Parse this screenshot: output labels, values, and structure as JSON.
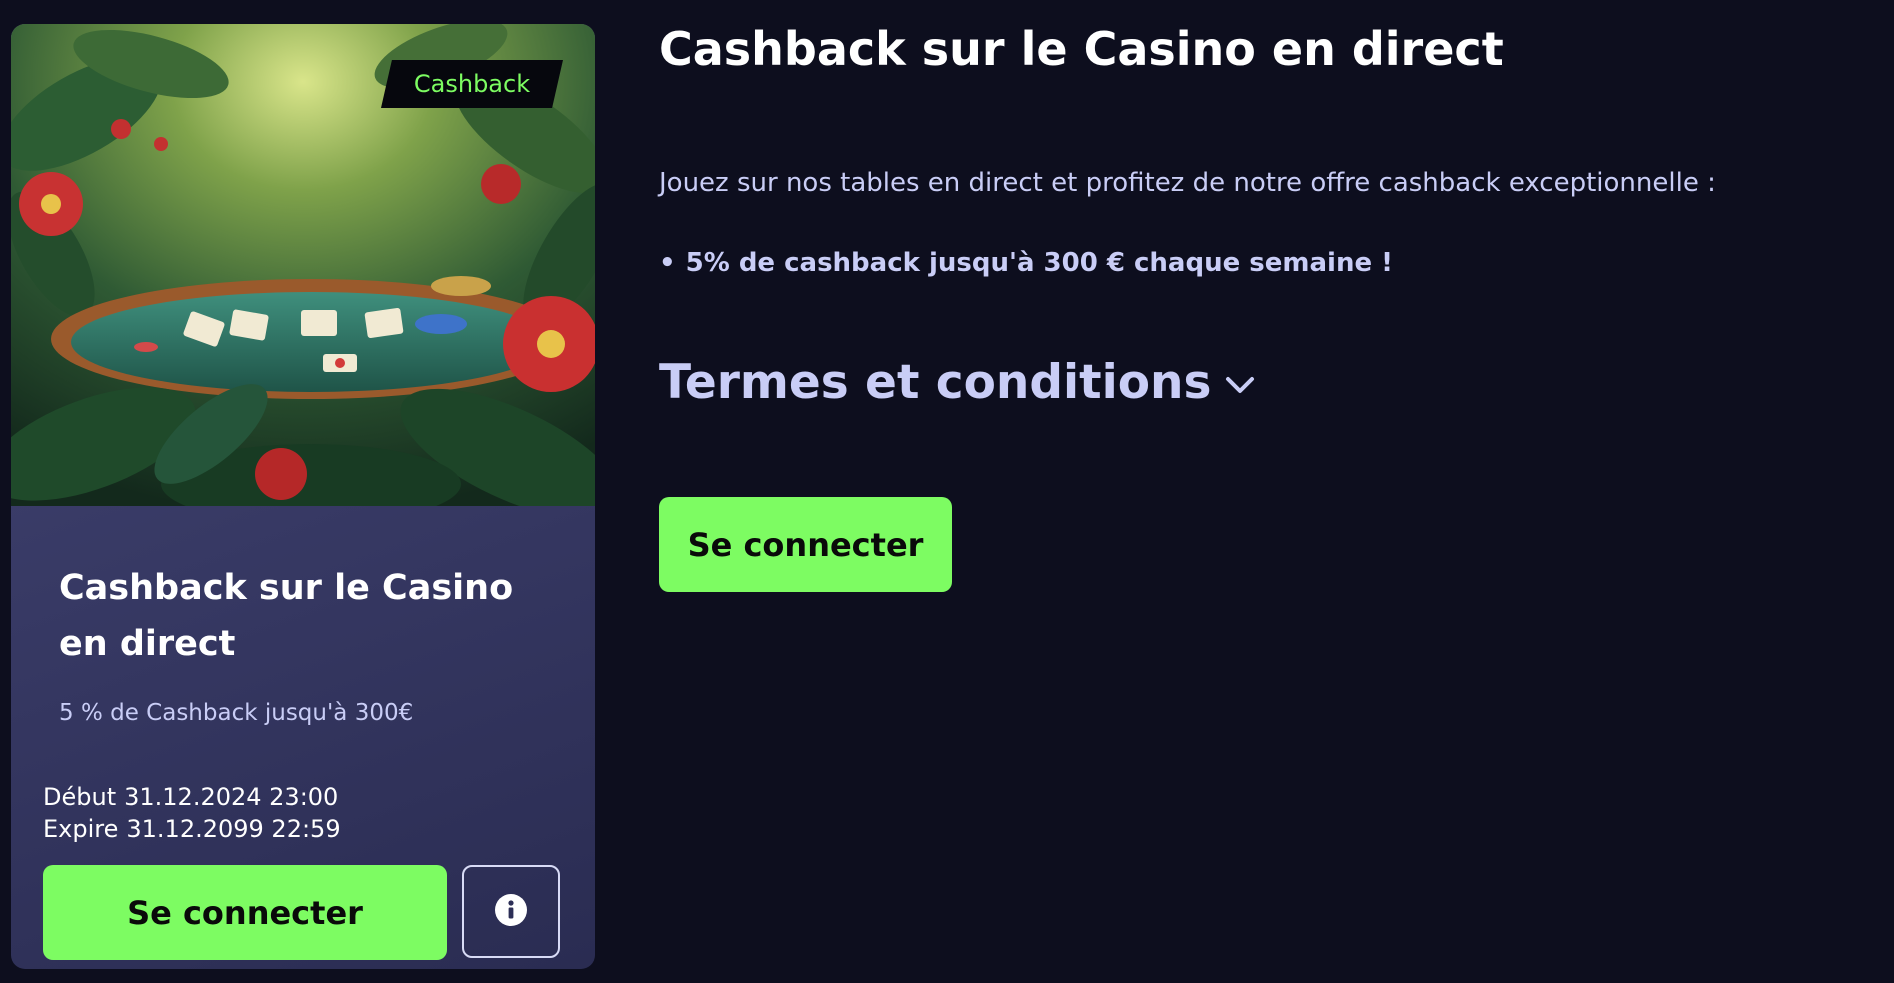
{
  "colors": {
    "background": "#0d0e1e",
    "accent_green": "#7dfc62",
    "text_lavender": "#c9cdf6",
    "card_gradient_top": "#5c5f8e",
    "card_gradient_bottom": "#2a2c52"
  },
  "card": {
    "image_alt": "jungle casino table illustration",
    "badge_label": "Cashback",
    "title": "Cashback sur le Casino en direct",
    "subtitle": "5 % de Cashback jusqu'à 300€",
    "start_label": "Début",
    "start_date": "31.12.2024 23:00",
    "end_label": "Expire",
    "end_date": "31.12.2099 22:59",
    "login_label": "Se connecter",
    "info_icon": "info-icon"
  },
  "main": {
    "title": "Cashback sur le Casino en direct",
    "intro": "Jouez sur nos tables en direct et profitez de notre offre cashback exceptionnelle :",
    "bullet_symbol": "•",
    "bullet_text": "5% de cashback jusqu'à 300 € chaque semaine !",
    "terms_label": "Termes et conditions",
    "terms_icon": "chevron-down-icon",
    "login_label": "Se connecter"
  }
}
